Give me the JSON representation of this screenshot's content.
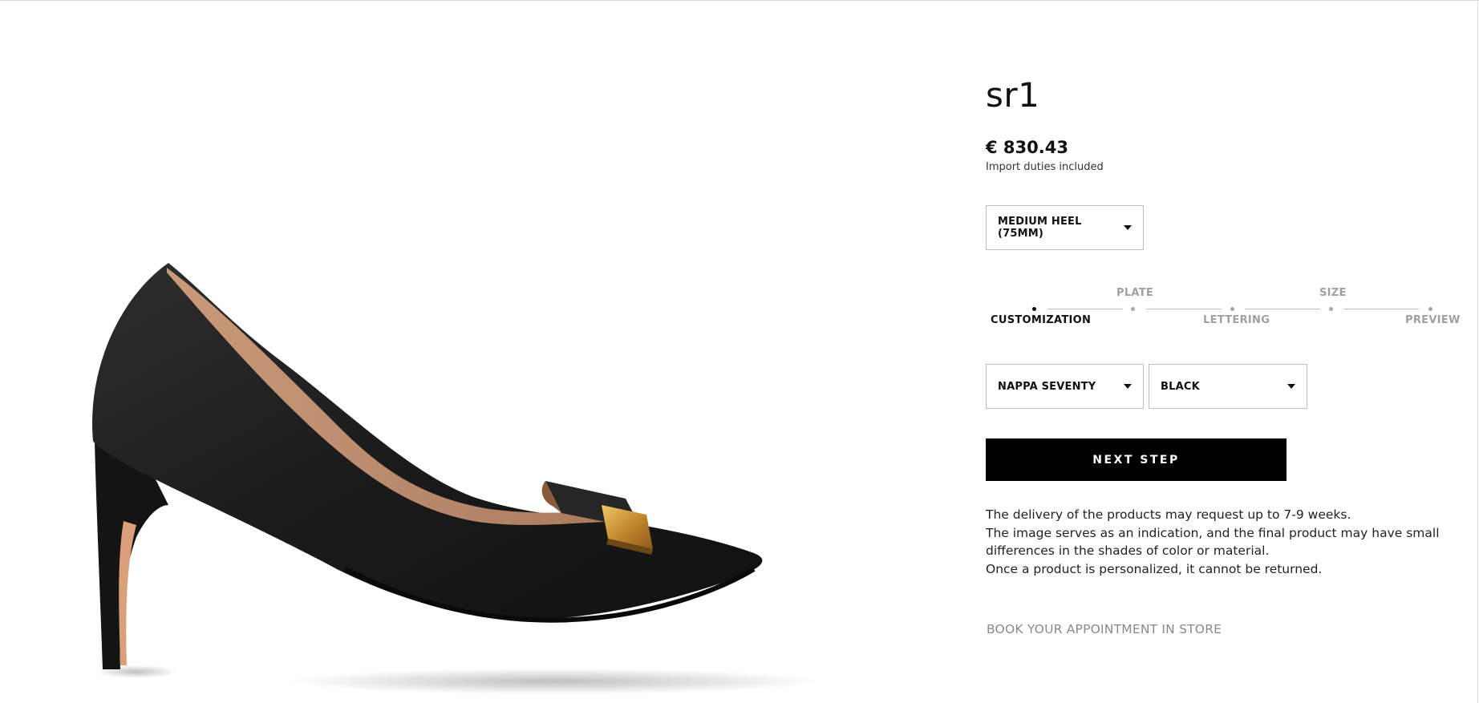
{
  "product": {
    "title": "sr1",
    "price": "€ 830.43",
    "duties_note": "Import duties included"
  },
  "heel_select": {
    "value": "MEDIUM HEEL (75MM)"
  },
  "stepper": {
    "steps": [
      {
        "label": "CUSTOMIZATION",
        "active": true
      },
      {
        "label": "PLATE",
        "active": false
      },
      {
        "label": "LETTERING",
        "active": false
      },
      {
        "label": "SIZE",
        "active": false
      },
      {
        "label": "PREVIEW",
        "active": false
      }
    ]
  },
  "material_select": {
    "value": "NAPPA SEVENTY"
  },
  "color_select": {
    "value": "BLACK"
  },
  "next_button": {
    "label": "NEXT STEP"
  },
  "info": {
    "delivery": "The delivery of the products may request up to 7-9 weeks.",
    "image_note": "The image serves as an indication, and the final product may have small differences in the shades of color or material.",
    "returns": "Once a product is personalized, it cannot be returned."
  },
  "book_link": {
    "label": "BOOK YOUR APPOINTMENT IN STORE"
  },
  "icons": {
    "dropdown": "caret-down-icon"
  },
  "colors": {
    "button_bg": "#000000",
    "muted_text": "#a0a0a0",
    "border": "#bdbdbd"
  }
}
